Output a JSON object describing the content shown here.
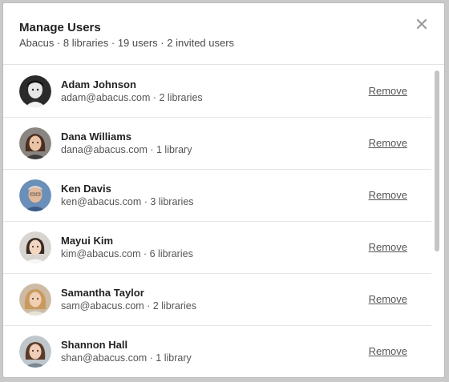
{
  "header": {
    "title": "Manage Users",
    "subtitle": "Abacus · 8 libraries · 19 users · 2 invited users"
  },
  "remove_label": "Remove",
  "users": [
    {
      "name": "Adam Johnson",
      "meta": "adam@abacus.com · 2 libraries"
    },
    {
      "name": "Dana Williams",
      "meta": "dana@abacus.com · 1 library"
    },
    {
      "name": "Ken Davis",
      "meta": "ken@abacus.com · 3 libraries"
    },
    {
      "name": "Mayui Kim",
      "meta": "kim@abacus.com · 6 libraries"
    },
    {
      "name": "Samantha Taylor",
      "meta": "sam@abacus.com · 2 libraries"
    },
    {
      "name": "Shannon Hall",
      "meta": "shan@abacus.com · 1 library"
    }
  ]
}
